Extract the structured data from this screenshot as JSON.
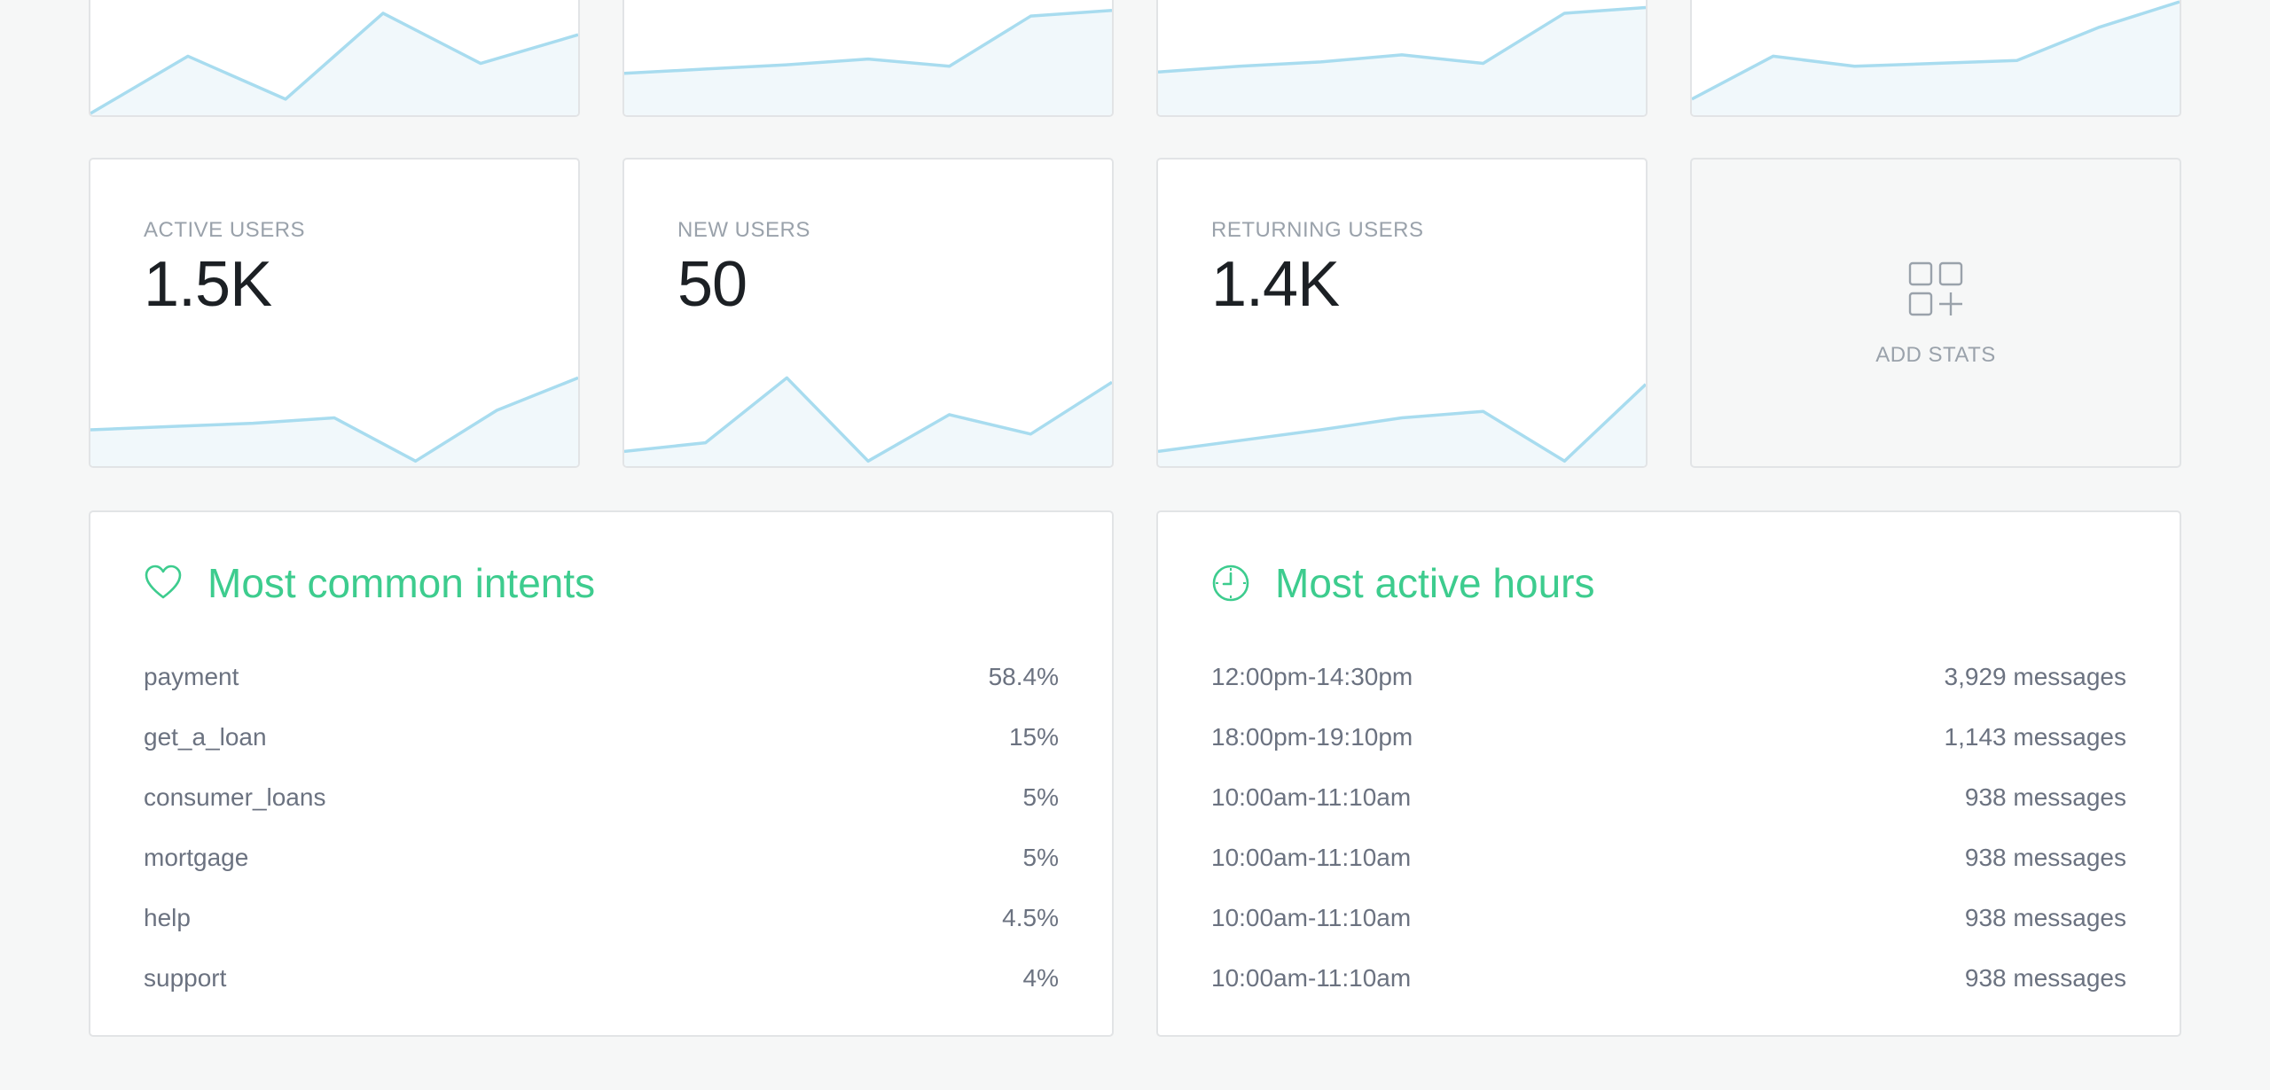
{
  "top_sparklines": [
    {
      "values": [
        0,
        4,
        1,
        7,
        3.5,
        5.5
      ],
      "max": 8
    },
    {
      "values": [
        2.8,
        3.1,
        3.4,
        3.8,
        3.3,
        6.8,
        7.2
      ],
      "max": 8
    },
    {
      "values": [
        2.9,
        3.3,
        3.6,
        4.1,
        3.5,
        7.0,
        7.4
      ],
      "max": 8
    },
    {
      "values": [
        1.0,
        4.0,
        3.3,
        3.5,
        3.7,
        6.0,
        7.8
      ],
      "max": 8
    }
  ],
  "stats": [
    {
      "label": "ACTIVE USERS",
      "value": "1.5K",
      "spark": [
        3.2,
        3.5,
        3.8,
        4.3,
        0.3,
        5.0,
        8.0
      ],
      "max": 10
    },
    {
      "label": "NEW USERS",
      "value": "50",
      "spark": [
        1.2,
        2.0,
        8.0,
        0.3,
        4.6,
        2.8,
        7.6
      ],
      "max": 10
    },
    {
      "label": "RETURNING USERS",
      "value": "1.4K",
      "spark": [
        1.2,
        2.2,
        3.2,
        4.3,
        4.9,
        0.3,
        7.4
      ],
      "max": 10
    }
  ],
  "add_stats": {
    "label": "ADD STATS",
    "icon": "grid-plus-icon"
  },
  "intents": {
    "title": "Most common intents",
    "icon": "heart-icon",
    "rows": [
      {
        "name": "payment",
        "value": "58.4%"
      },
      {
        "name": "get_a_loan",
        "value": "15%"
      },
      {
        "name": "consumer_loans",
        "value": "5%"
      },
      {
        "name": "mortgage",
        "value": "5%"
      },
      {
        "name": "help",
        "value": "4.5%"
      },
      {
        "name": "support",
        "value": "4%"
      }
    ]
  },
  "hours": {
    "title": "Most active hours",
    "icon": "clock-icon",
    "rows": [
      {
        "range": "12:00pm-14:30pm",
        "count": "3,929 messages"
      },
      {
        "range": "18:00pm-19:10pm",
        "count": "1,143 messages"
      },
      {
        "range": "10:00am-11:10am",
        "count": "938 messages"
      },
      {
        "range": "10:00am-11:10am",
        "count": "938 messages"
      },
      {
        "range": "10:00am-11:10am",
        "count": "938 messages"
      },
      {
        "range": "10:00am-11:10am",
        "count": "938 messages"
      }
    ]
  },
  "colors": {
    "spark_line": "#a8dcef",
    "spark_fill": "#f1f8fb",
    "accent": "#3dcc8e"
  }
}
